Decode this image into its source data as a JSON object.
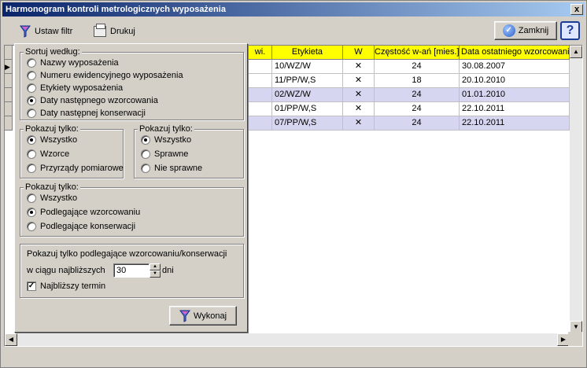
{
  "window": {
    "title": "Harmonogram kontroli metrologicznych wyposażenia",
    "close": "x"
  },
  "toolbar": {
    "filter_label": "Ustaw filtr",
    "print_label": "Drukuj",
    "close_label": "Zamknij",
    "help_label": "?"
  },
  "table": {
    "columns": [
      "wi.",
      "Etykieta",
      "W",
      "Częstość w-ań [mies.]",
      "Data ostatniego wzorcowania"
    ],
    "rows": [
      {
        "etykieta": "10/WZ/W",
        "w": "✕",
        "czestosc": "24",
        "data": "30.08.2007"
      },
      {
        "etykieta": "11/PP/W,S",
        "w": "✕",
        "czestosc": "18",
        "data": "20.10.2010"
      },
      {
        "etykieta": "02/WZ/W",
        "w": "✕",
        "czestosc": "24",
        "data": "01.01.2010"
      },
      {
        "etykieta": "01/PP/W,S",
        "w": "✕",
        "czestosc": "24",
        "data": "22.10.2011"
      },
      {
        "etykieta": "07/PP/W,S",
        "w": "✕",
        "czestosc": "24",
        "data": "22.10.2011"
      }
    ]
  },
  "filter": {
    "sort": {
      "legend": "Sortuj według:",
      "options": [
        "Nazwy wyposażenia",
        "Numeru ewidencyjnego wyposażenia",
        "Etykiety wyposażenia",
        "Daty następnego wzorcowania",
        "Daty następnej konserwacji"
      ],
      "selected_index": 3
    },
    "show1": {
      "legend": "Pokazuj tylko:",
      "options": [
        "Wszystko",
        "Wzorce",
        "Przyrządy pomiarowe"
      ],
      "selected_index": 0
    },
    "show2": {
      "legend": "Pokazuj tylko:",
      "options": [
        "Wszystko",
        "Sprawne",
        "Nie sprawne"
      ],
      "selected_index": 0
    },
    "show3": {
      "legend": "Pokazuj tylko:",
      "options": [
        "Wszystko",
        "Podlegające wzorcowaniu",
        "Podlegające konserwacji"
      ],
      "selected_index": 1
    },
    "upcoming": {
      "caption": "Pokazuj tylko podlegające wzorcowaniu/konserwacji",
      "within_label": "w ciągu najbliższych",
      "days_value": "30",
      "days_unit": "dni",
      "nearest_label": "Najbliższy termin",
      "nearest_checked": true
    },
    "execute_label": "Wykonaj"
  }
}
